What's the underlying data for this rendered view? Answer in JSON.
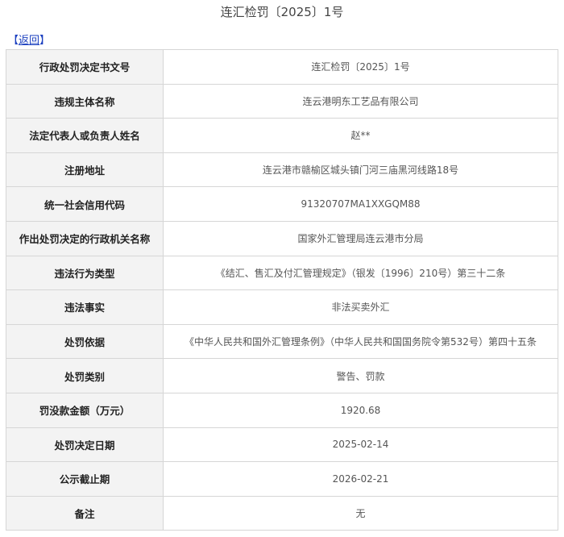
{
  "page": {
    "title": "连汇检罚〔2025〕1号",
    "back_link": {
      "bracket_open": "【",
      "label": "返回",
      "bracket_close": "】"
    }
  },
  "table": {
    "rows": [
      {
        "label": "行政处罚决定书文号",
        "value": "连汇检罚〔2025〕1号"
      },
      {
        "label": "违规主体名称",
        "value": "连云港明东工艺品有限公司"
      },
      {
        "label": "法定代表人或负责人姓名",
        "value": "赵**"
      },
      {
        "label": "注册地址",
        "value": "连云港市赣榆区城头镇门河三庙黑河线路18号"
      },
      {
        "label": "统一社会信用代码",
        "value": "91320707MA1XXGQM88"
      },
      {
        "label": "作出处罚决定的行政机关名称",
        "value": "国家外汇管理局连云港市分局"
      },
      {
        "label": "违法行为类型",
        "value": "《结汇、售汇及付汇管理规定》（银发〔1996〕210号）第三十二条"
      },
      {
        "label": "违法事实",
        "value": "非法买卖外汇"
      },
      {
        "label": "处罚依据",
        "value": "《中华人民共和国外汇管理条例》（中华人民共和国国务院令第532号）第四十五条"
      },
      {
        "label": "处罚类别",
        "value": "警告、罚款"
      },
      {
        "label": "罚没款金额（万元）",
        "value": "1920.68"
      },
      {
        "label": "处罚决定日期",
        "value": "2025-02-14"
      },
      {
        "label": "公示截止期",
        "value": "2026-02-21"
      },
      {
        "label": "备注",
        "value": "无"
      }
    ]
  },
  "colors": {
    "link": "#1a3fbf",
    "label_background": "#f3f3f3",
    "border": "#d6d6d6"
  }
}
